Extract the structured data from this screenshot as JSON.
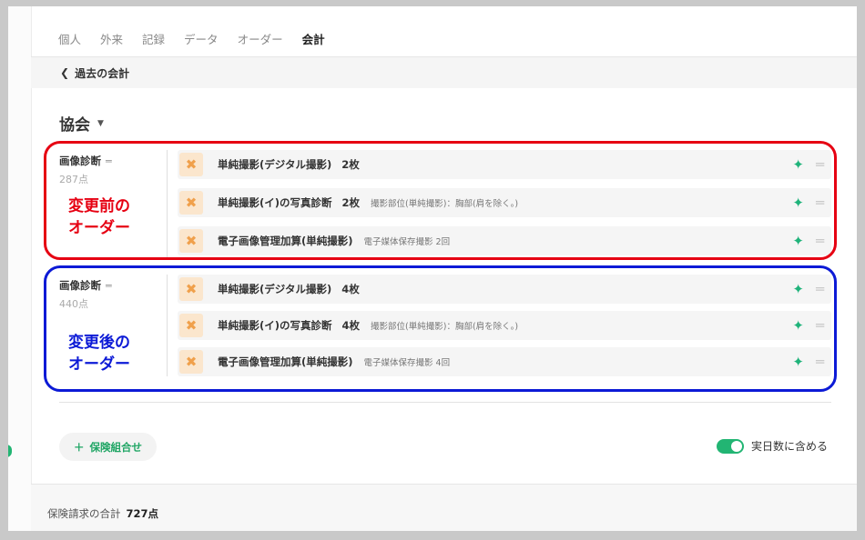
{
  "tabs": [
    {
      "label": "個人"
    },
    {
      "label": "外来"
    },
    {
      "label": "記録"
    },
    {
      "label": "データ"
    },
    {
      "label": "オーダー"
    },
    {
      "label": "会計",
      "active": true
    }
  ],
  "back": {
    "label": "過去の会計",
    "icon": "chevron-left-icon"
  },
  "section": {
    "title": "協会",
    "icon": "caret-down-icon"
  },
  "groups": [
    {
      "label": "画像診断",
      "points": "287点",
      "annotation_line1": "変更前の",
      "annotation_line2": "オーダー",
      "annotation_color": "#e60012",
      "items": [
        {
          "name": "単純撮影(デジタル撮影)",
          "qty": "2枚",
          "sub": ""
        },
        {
          "name": "単純撮影(イ)の写真診断",
          "qty": "2枚",
          "sub": "撮影部位(単純撮影)：胸部(肩を除く。)"
        },
        {
          "name": "電子画像管理加算(単純撮影)",
          "qty": "",
          "sub": "電子媒体保存撮影 2回"
        }
      ]
    },
    {
      "label": "画像診断",
      "points": "440点",
      "annotation_line1": "変更後の",
      "annotation_line2": "オーダー",
      "annotation_color": "#0c1ad6",
      "items": [
        {
          "name": "単純撮影(デジタル撮影)",
          "qty": "4枚",
          "sub": ""
        },
        {
          "name": "単純撮影(イ)の写真診断",
          "qty": "4枚",
          "sub": "撮影部位(単純撮影)：胸部(肩を除く。)"
        },
        {
          "name": "電子画像管理加算(単純撮影)",
          "qty": "",
          "sub": "電子媒体保存撮影 4回"
        }
      ]
    }
  ],
  "add_button": {
    "label": "保険組合せ",
    "icon": "plus-icon"
  },
  "toggle": {
    "label": "実日数に含める",
    "on": true
  },
  "footer": {
    "label": "保険請求の合計",
    "value": "727点"
  },
  "colors": {
    "accent": "#22b573",
    "item_icon_bg": "#fbe6cd",
    "item_icon": "#f0a04b"
  }
}
